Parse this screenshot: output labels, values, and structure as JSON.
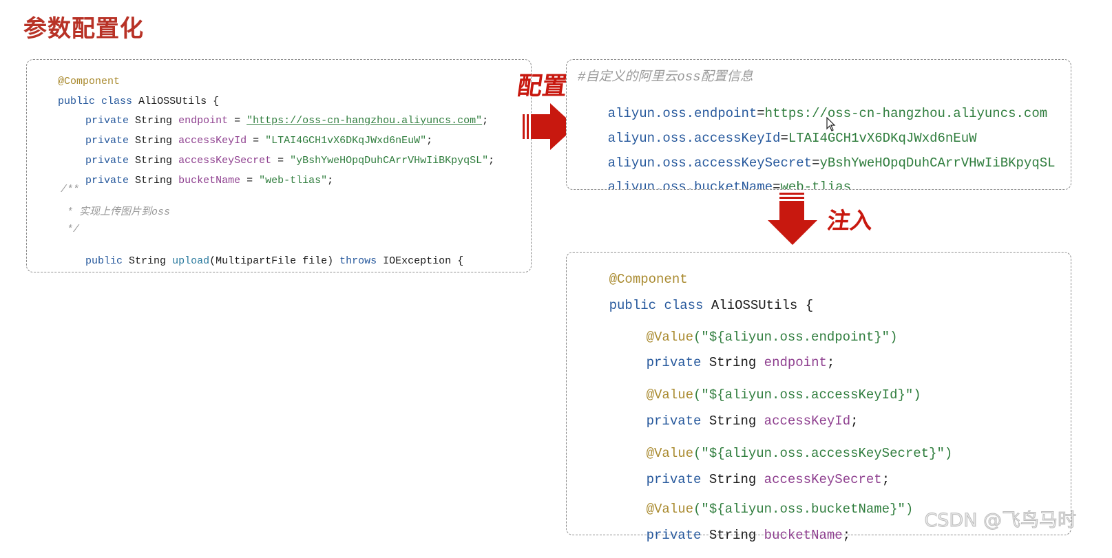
{
  "page": {
    "title": "参数配置化"
  },
  "labels": {
    "config": "配置",
    "inject": "注入"
  },
  "left_code": {
    "annotation": "@Component",
    "class_line": {
      "kw_public": "public",
      "kw_class": "class",
      "name": "AliOSSUtils",
      "brace": "{"
    },
    "fields": [
      {
        "kw": "private",
        "type": "String",
        "name": "endpoint",
        "eq": " = ",
        "value": "\"https://oss-cn-hangzhou.aliyuncs.com\"",
        "semi": ";"
      },
      {
        "kw": "private",
        "type": "String",
        "name": "accessKeyId",
        "eq": " = ",
        "value": "\"LTAI4GCH1vX6DKqJWxd6nEuW\"",
        "semi": ";"
      },
      {
        "kw": "private",
        "type": "String",
        "name": "accessKeySecret",
        "eq": " = ",
        "value": "\"yBshYweHOpqDuhCArrVHwIiBKpyqSL\"",
        "semi": ";"
      },
      {
        "kw": "private",
        "type": "String",
        "name": "bucketName",
        "eq": " = ",
        "value": "\"web-tlias\"",
        "semi": ";"
      }
    ],
    "comment": [
      "/**",
      " * 实现上传图片到oss",
      " */"
    ],
    "method": {
      "kw_public": "public",
      "type": "String",
      "name": "upload",
      "params": "(MultipartFile file)",
      "kw_throws": "throws",
      "exception": "IOException",
      "brace": "{"
    }
  },
  "properties": {
    "comment": "#自定义的阿里云oss配置信息",
    "entries": [
      {
        "key": "aliyun.oss.endpoint",
        "value": "https://oss-cn-hangzhou.aliyuncs.com"
      },
      {
        "key": "aliyun.oss.accessKeyId",
        "value": "LTAI4GCH1vX6DKqJWxd6nEuW"
      },
      {
        "key": "aliyun.oss.accessKeySecret",
        "value": "yBshYweHOpqDuhCArrVHwIiBKpyqSL"
      },
      {
        "key": "aliyun.oss.bucketName",
        "value": "web-tlias"
      }
    ]
  },
  "right_code": {
    "annotation": "@Component",
    "class_line": {
      "kw_public": "public",
      "kw_class": "class",
      "name": "AliOSSUtils",
      "brace": "{"
    },
    "fields": [
      {
        "ann": "@Value",
        "arg": "(\"${aliyun.oss.endpoint}\")",
        "kw": "private",
        "type": "String",
        "name": "endpoint",
        "semi": ";"
      },
      {
        "ann": "@Value",
        "arg": "(\"${aliyun.oss.accessKeyId}\")",
        "kw": "private",
        "type": "String",
        "name": "accessKeyId",
        "semi": ";"
      },
      {
        "ann": "@Value",
        "arg": "(\"${aliyun.oss.accessKeySecret}\")",
        "kw": "private",
        "type": "String",
        "name": "accessKeySecret",
        "semi": ";"
      },
      {
        "ann": "@Value",
        "arg": "(\"${aliyun.oss.bucketName}\")",
        "kw": "private",
        "type": "String",
        "name": "bucketName",
        "semi": ";"
      }
    ]
  },
  "watermark": "CSDN @飞鸟马时",
  "colors": {
    "title": "#b83226",
    "arrow": "#c8180f",
    "keyword": "#26589c",
    "annotation": "#a98a2f",
    "field": "#8e3f8f",
    "string": "#2f7d3d"
  }
}
